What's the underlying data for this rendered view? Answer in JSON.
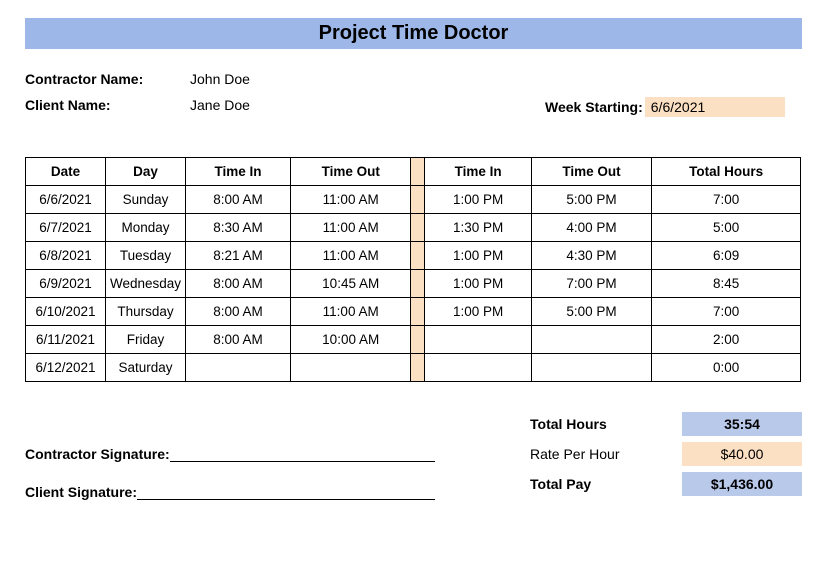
{
  "title": "Project Time Doctor",
  "contractor_name_label": "Contractor Name:",
  "contractor_name": "John Doe",
  "client_name_label": "Client Name:",
  "client_name": "Jane Doe",
  "week_starting_label": "Week Starting:",
  "week_starting": "6/6/2021",
  "columns": {
    "date": "Date",
    "day": "Day",
    "time_in_1": "Time In",
    "time_out_1": "Time Out",
    "time_in_2": "Time In",
    "time_out_2": "Time Out",
    "total_hours": "Total Hours"
  },
  "rows": [
    {
      "date": "6/6/2021",
      "day": "Sunday",
      "in1": "8:00 AM",
      "out1": "11:00 AM",
      "in2": "1:00 PM",
      "out2": "5:00 PM",
      "total": "7:00"
    },
    {
      "date": "6/7/2021",
      "day": "Monday",
      "in1": "8:30 AM",
      "out1": "11:00 AM",
      "in2": "1:30 PM",
      "out2": "4:00 PM",
      "total": "5:00"
    },
    {
      "date": "6/8/2021",
      "day": "Tuesday",
      "in1": "8:21 AM",
      "out1": "11:00 AM",
      "in2": "1:00 PM",
      "out2": "4:30 PM",
      "total": "6:09"
    },
    {
      "date": "6/9/2021",
      "day": "Wednesday",
      "in1": "8:00 AM",
      "out1": "10:45 AM",
      "in2": "1:00 PM",
      "out2": "7:00 PM",
      "total": "8:45"
    },
    {
      "date": "6/10/2021",
      "day": "Thursday",
      "in1": "8:00 AM",
      "out1": "11:00 AM",
      "in2": "1:00 PM",
      "out2": "5:00 PM",
      "total": "7:00"
    },
    {
      "date": "6/11/2021",
      "day": "Friday",
      "in1": "8:00 AM",
      "out1": "10:00 AM",
      "in2": "",
      "out2": "",
      "total": "2:00"
    },
    {
      "date": "6/12/2021",
      "day": "Saturday",
      "in1": "",
      "out1": "",
      "in2": "",
      "out2": "",
      "total": "0:00"
    }
  ],
  "summary": {
    "total_hours_label": "Total Hours",
    "total_hours": "35:54",
    "rate_label": "Rate Per Hour",
    "rate": "$40.00",
    "total_pay_label": "Total Pay",
    "total_pay": "$1,436.00"
  },
  "signatures": {
    "contractor": "Contractor Signature:",
    "client": "Client Signature:"
  }
}
